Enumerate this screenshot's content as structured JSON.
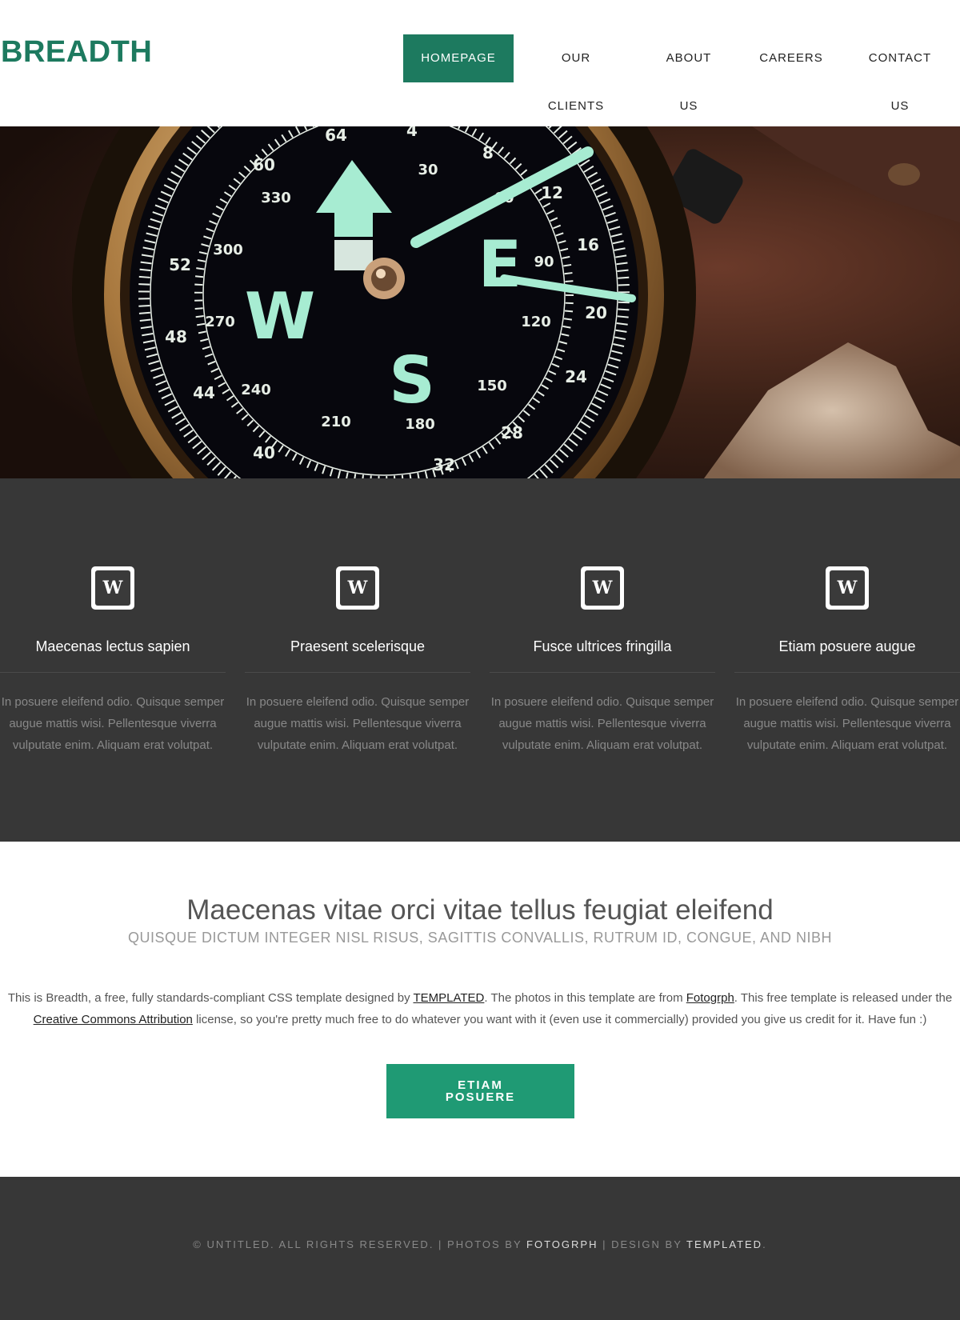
{
  "site": {
    "logo": "BREADTH",
    "brand_color": "#1d7a5f"
  },
  "nav": {
    "items": [
      {
        "line1": "HOMEPAGE",
        "line2": "",
        "active": true
      },
      {
        "line1": "OUR",
        "line2": "CLIENTS",
        "active": false
      },
      {
        "line1": "ABOUT",
        "line2": "US",
        "active": false
      },
      {
        "line1": "CAREERS",
        "line2": "",
        "active": false
      },
      {
        "line1": "CONTACT",
        "line2": "US",
        "active": false
      }
    ]
  },
  "hero": {
    "image": "compass-photo",
    "compass_letters": {
      "west": "W",
      "east": "E",
      "south": "S"
    }
  },
  "features": [
    {
      "icon": "w-badge-icon",
      "title": "Maecenas lectus sapien",
      "text": "In posuere eleifend odio. Quisque semper augue mattis wisi. Pellentesque viverra vulputate enim. Aliquam erat volutpat."
    },
    {
      "icon": "w-badge-icon",
      "title": "Praesent scelerisque",
      "text": "In posuere eleifend odio. Quisque semper augue mattis wisi. Pellentesque viverra vulputate enim. Aliquam erat volutpat."
    },
    {
      "icon": "w-badge-icon",
      "title": "Fusce ultrices fringilla",
      "text": "In posuere eleifend odio. Quisque semper augue mattis wisi. Pellentesque viverra vulputate enim. Aliquam erat volutpat."
    },
    {
      "icon": "w-badge-icon",
      "title": "Etiam posuere augue",
      "text": "In posuere eleifend odio. Quisque semper augue mattis wisi. Pellentesque viverra vulputate enim. Aliquam erat volutpat."
    }
  ],
  "main": {
    "title": "Maecenas vitae orci vitae tellus feugiat eleifend",
    "subtitle": "QUISQUE DICTUM INTEGER NISL RISUS, SAGITTIS CONVALLIS, RUTRUM ID, CONGUE, AND NIBH",
    "text_1": "This is Breadth, a free, fully standards-compliant CSS template designed by ",
    "link_1": "TEMPLATED",
    "text_2": ". The photos in this template are from ",
    "link_2": "Fotogrph",
    "text_3": ". This free template is released under the ",
    "link_3": "Creative Commons Attribution",
    "text_4": " license, so you're pretty much free to do whatever you want with it (even use it commercially) provided you give us credit for it. Have fun :)",
    "cta_line1": "ETIAM",
    "cta_line2": "POSUERE",
    "cta_color": "#1f9a74"
  },
  "footer": {
    "text_1": "© UNTITLED. ALL RIGHTS RESERVED. | PHOTOS BY ",
    "link_1": "FOTOGRPH",
    "text_2": " | DESIGN BY ",
    "link_2": "TEMPLATED",
    "text_3": "."
  }
}
